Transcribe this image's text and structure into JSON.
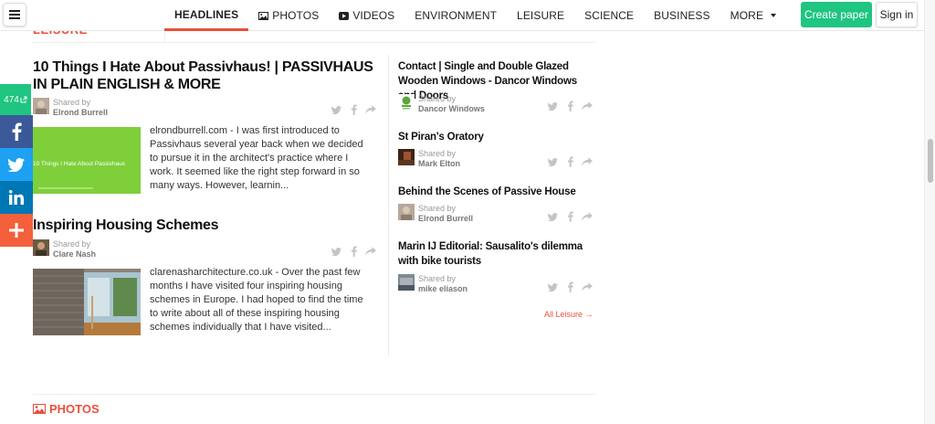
{
  "nav": {
    "items": [
      {
        "label": "HEADLINES",
        "icon": "",
        "active": true
      },
      {
        "label": "PHOTOS",
        "icon": "image-icon",
        "active": false
      },
      {
        "label": "VIDEOS",
        "icon": "video-icon",
        "active": false
      },
      {
        "label": "ENVIRONMENT",
        "icon": "",
        "active": false
      },
      {
        "label": "LEISURE",
        "icon": "",
        "active": false
      },
      {
        "label": "SCIENCE",
        "icon": "",
        "active": false
      },
      {
        "label": "BUSINESS",
        "icon": "",
        "active": false
      },
      {
        "label": "MORE",
        "icon": "caret-down-icon",
        "active": false
      }
    ],
    "create_label": "Create paper",
    "signin_label": "Sign in"
  },
  "share": {
    "count": "474"
  },
  "section": {
    "title": "LEISURE"
  },
  "left_articles": [
    {
      "title": "10 Things I Hate About Passivhaus! | PASSIVHAUS IN PLAIN ENGLISH & MORE",
      "shared_by": "Shared by",
      "sharer": "Elrond Burrell",
      "thumb_text": "10 Things I Hate About Passivhaus",
      "snippet": "elrondburrell.com - I was first introduced to Passivhaus several year back when we decided to pursue it in the architect's practice where I work. It seemed like the right step forward in so many ways. However, learnin..."
    },
    {
      "title": "Inspiring Housing Schemes",
      "shared_by": "Shared by",
      "sharer": "Clare Nash",
      "snippet": "clarenasharchitecture.co.uk - Over the past few months I have visited four inspiring housing schemes in Europe. I had hoped to find the time to write about all of these inspiring housing schemes individually that I have visited..."
    }
  ],
  "right_articles": [
    {
      "title": "Contact | Single and Double Glazed Wooden Windows - Dancor Windows and Doors",
      "shared_by": "Shared by",
      "sharer": "Dancor Windows"
    },
    {
      "title": "St Piran's Oratory",
      "shared_by": "Shared by",
      "sharer": "Mark Elton"
    },
    {
      "title": "Behind the Scenes of Passive House",
      "shared_by": "Shared by",
      "sharer": "Elrond Burrell"
    },
    {
      "title": "Marin IJ Editorial: Sausalito's dilemma with bike tourists",
      "shared_by": "Shared by",
      "sharer": "mike eliason"
    }
  ],
  "all_leisure_label": "All Leisure →",
  "photos_title": "PHOTOS",
  "colors": {
    "accent": "#e8503a",
    "green": "#1fc580",
    "facebook": "#3b5998",
    "twitter": "#1da1f2",
    "linkedin": "#0077b5",
    "more": "#f4603c"
  }
}
